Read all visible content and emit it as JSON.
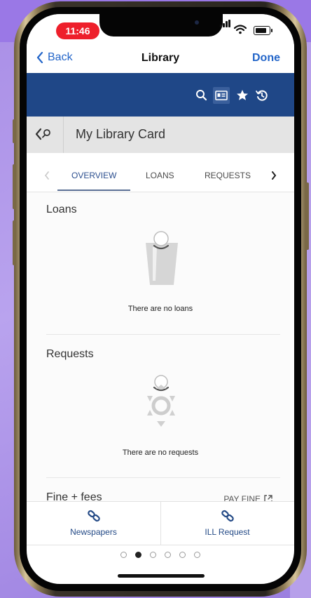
{
  "status_bar": {
    "time": "11:46"
  },
  "nav": {
    "back_label": "Back",
    "title": "Library",
    "done_label": "Done"
  },
  "toolbar": {
    "icons": [
      "search-icon",
      "library-card-icon",
      "star-icon",
      "history-icon"
    ]
  },
  "subheader": {
    "title": "My Library Card"
  },
  "tabs": {
    "items": [
      {
        "label": "OVERVIEW",
        "active": true
      },
      {
        "label": "LOANS",
        "active": false
      },
      {
        "label": "REQUESTS",
        "active": false
      }
    ]
  },
  "sections": {
    "loans": {
      "title": "Loans",
      "empty_text": "There are no loans"
    },
    "requests": {
      "title": "Requests",
      "empty_text": "There are no requests"
    },
    "fines": {
      "title": "Fine + fees",
      "action_label": "PAY FINE"
    }
  },
  "bottom_bar": {
    "buttons": [
      {
        "label": "Newspapers",
        "icon": "link-icon"
      },
      {
        "label": "ILL Request",
        "icon": "link-icon"
      }
    ]
  },
  "pager": {
    "count": 6,
    "current": 2
  },
  "colors": {
    "accent": "#2466c9",
    "header": "#1f4787",
    "tab_active": "#2c4f8f",
    "time_badge": "#ee1f2b"
  }
}
